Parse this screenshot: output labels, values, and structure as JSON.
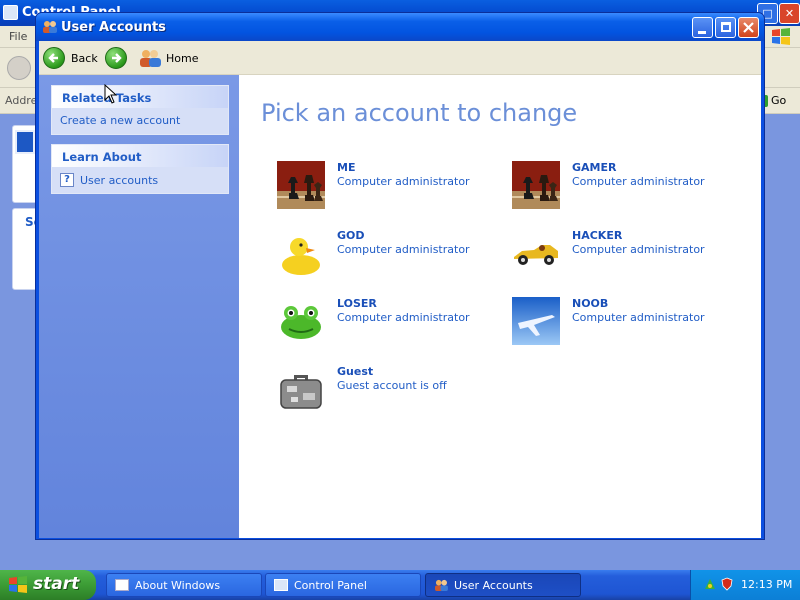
{
  "background_window": {
    "title": "Control Panel",
    "menu_file": "File",
    "address_label": "Address",
    "go_label": "Go",
    "panel1_header": "",
    "panel2_header": "Se"
  },
  "window": {
    "title": "User Accounts"
  },
  "nav": {
    "back_label": "Back",
    "home_label": "Home"
  },
  "sidebar": {
    "related_tasks": {
      "header": "Related Tasks",
      "items": [
        {
          "label": "Create a new account"
        }
      ]
    },
    "learn_about": {
      "header": "Learn About",
      "items": [
        {
          "label": "User accounts",
          "icon": "help-icon"
        }
      ]
    }
  },
  "main": {
    "heading": "Pick an account to change",
    "accounts": [
      {
        "name": "ME",
        "type": "Computer administrator",
        "picture": "chess-icon"
      },
      {
        "name": "GAMER",
        "type": "Computer administrator",
        "picture": "chess-icon"
      },
      {
        "name": "GOD",
        "type": "Computer administrator",
        "picture": "rubber-duck-icon"
      },
      {
        "name": "HACKER",
        "type": "Computer administrator",
        "picture": "race-car-icon"
      },
      {
        "name": "LOSER",
        "type": "Computer administrator",
        "picture": "frog-icon"
      },
      {
        "name": "NOOB",
        "type": "Computer administrator",
        "picture": "airplane-icon"
      },
      {
        "name": "Guest",
        "type": "Guest account is off",
        "picture": "suitcase-icon"
      }
    ]
  },
  "taskbar": {
    "start_label": "start",
    "tasks": [
      {
        "label": "About Windows"
      },
      {
        "label": "Control Panel"
      },
      {
        "label": "User Accounts"
      }
    ],
    "clock": "12:13 PM"
  },
  "colors": {
    "titlebar": "#0254e0",
    "sidebar": "#7a99e6",
    "heading": "#6b8fd8",
    "link": "#215dc6",
    "start": "#3c9c35"
  }
}
